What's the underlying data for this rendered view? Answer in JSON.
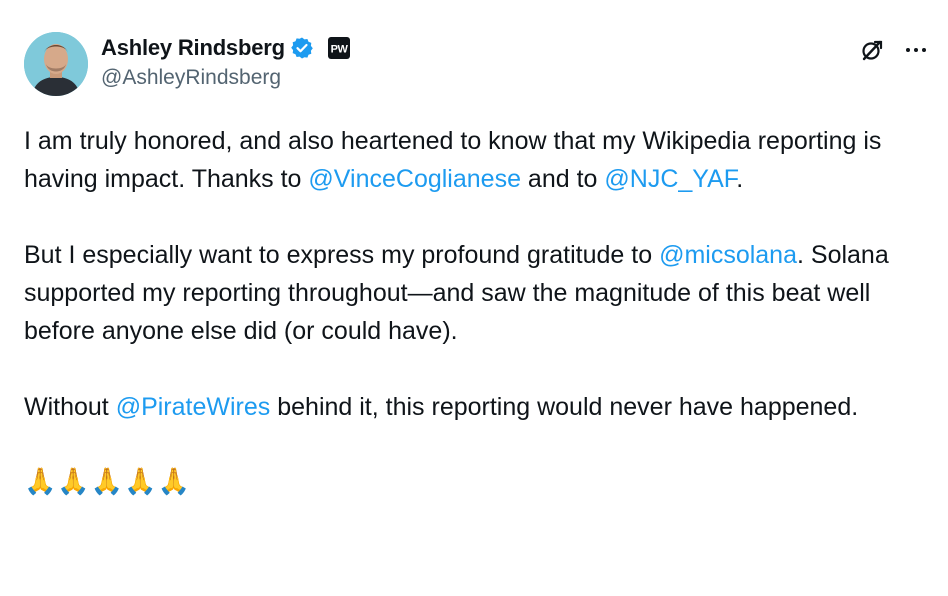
{
  "author": {
    "display_name": "Ashley Rindsberg",
    "handle": "@AshleyRindsberg",
    "affiliate_badge_text": "PW",
    "verified_badge": "verified-badge-icon",
    "avatar": "avatar-photo"
  },
  "icons": {
    "grok": "grok-icon",
    "more": "more-options-icon"
  },
  "tweet": {
    "p1": {
      "t1": "I am truly honored, and also heartened to know that my Wikipedia reporting is having impact. Thanks to ",
      "m1": "@VinceCoglianese",
      "t2": " and to ",
      "m2": "@NJC_YAF",
      "t3": "."
    },
    "p2": {
      "t1": "But I especially want to express my profound gratitude to ",
      "m1": "@micsolana",
      "t2": ". Solana supported my reporting throughout—and saw the magnitude of this beat well before anyone else did (or could have)."
    },
    "p3": {
      "t1": "Without ",
      "m1": "@PirateWires",
      "t2": " behind it, this reporting would never have happened."
    },
    "emojis": [
      "🙏",
      "🙏",
      "🙏",
      "🙏",
      "🙏"
    ]
  },
  "colors": {
    "link": "#1d9bf0",
    "text": "#0f1419",
    "secondary": "#536471",
    "verified": "#1d9bf0"
  }
}
